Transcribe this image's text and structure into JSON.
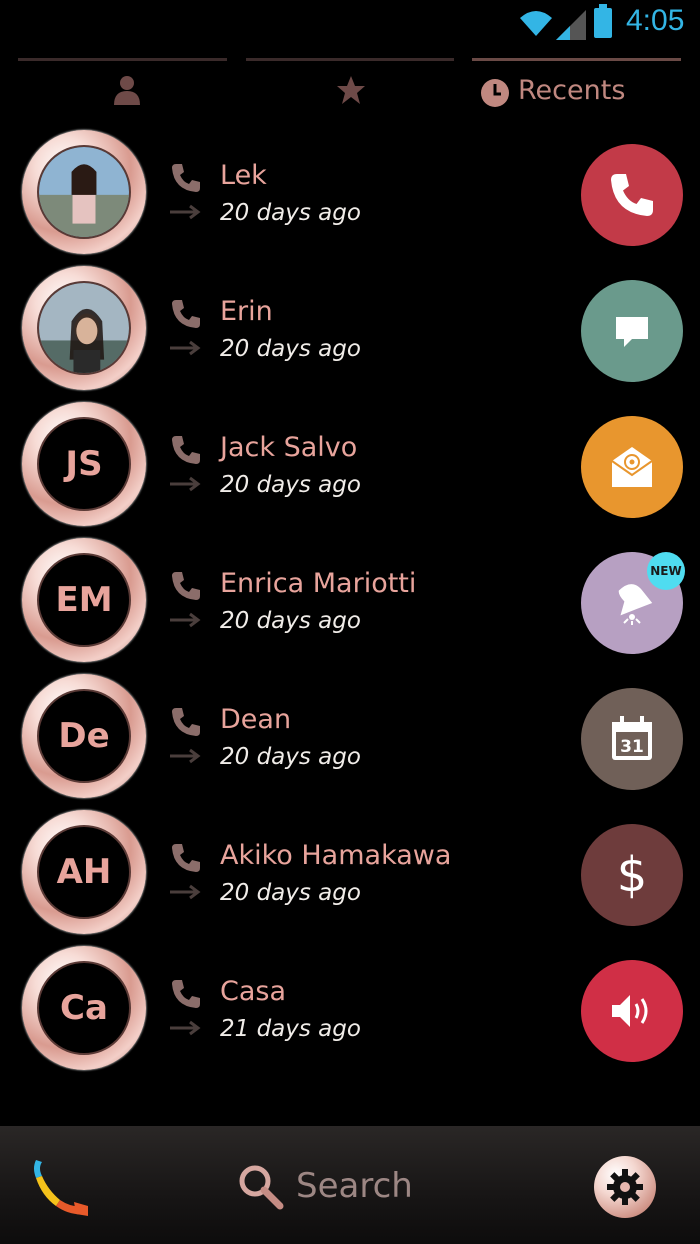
{
  "status_bar": {
    "time": "4:05"
  },
  "tabs": [
    {
      "icon": "person-icon",
      "label": ""
    },
    {
      "icon": "star-icon",
      "label": ""
    },
    {
      "icon": "clock-icon",
      "label": "Recents"
    }
  ],
  "contacts": [
    {
      "name": "Lek",
      "time": "20 days ago",
      "initials": "",
      "photo": true
    },
    {
      "name": "Erin",
      "time": "20 days ago",
      "initials": "",
      "photo": true
    },
    {
      "name": "Jack Salvo",
      "time": "20 days ago",
      "initials": "JS",
      "photo": false
    },
    {
      "name": "Enrica Mariotti",
      "time": "20 days ago",
      "initials": "EM",
      "photo": false
    },
    {
      "name": "Dean",
      "time": "20 days ago",
      "initials": "De",
      "photo": false
    },
    {
      "name": "Akiko Hamakawa",
      "time": "20 days ago",
      "initials": "AH",
      "photo": false
    },
    {
      "name": "Casa",
      "time": "21 days ago",
      "initials": "Ca",
      "photo": false
    }
  ],
  "actions": [
    {
      "icon": "phone-icon",
      "color": "#c23a48"
    },
    {
      "icon": "message-icon",
      "color": "#6a9a8c"
    },
    {
      "icon": "email-icon",
      "color": "#e8962e"
    },
    {
      "icon": "alarm-bell-icon",
      "color": "#b7a0c2"
    },
    {
      "icon": "calendar-icon",
      "color": "#706058",
      "calendar_day": "31"
    },
    {
      "icon": "dollar-icon",
      "color": "#6e3c3c",
      "symbol": "$"
    },
    {
      "icon": "speaker-icon",
      "color": "#d02f46"
    }
  ],
  "badge": {
    "label": "NEW"
  },
  "bottom_bar": {
    "search_label": "Search"
  }
}
